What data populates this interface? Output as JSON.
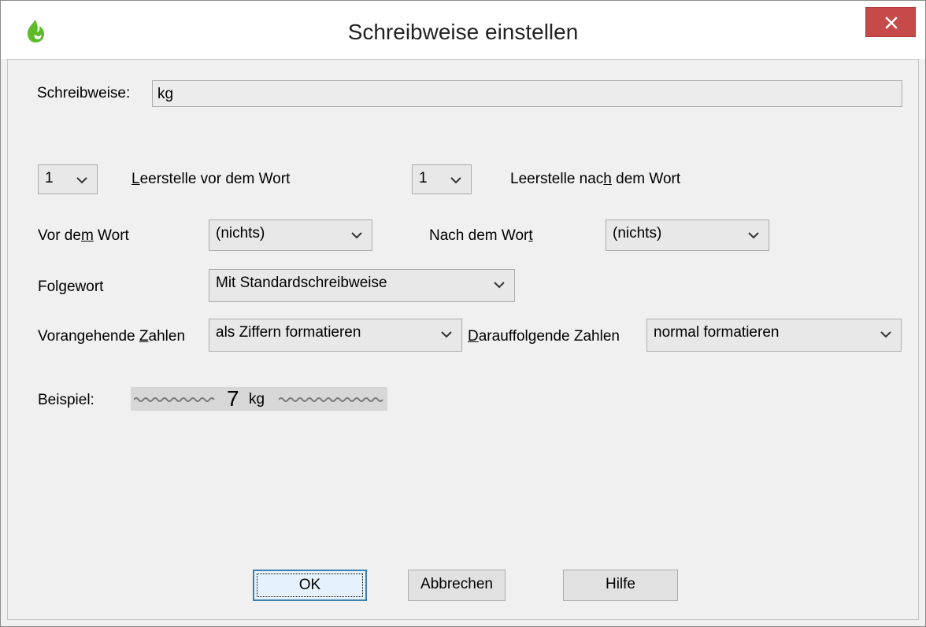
{
  "window": {
    "title": "Schreibweise einstellen",
    "close_label": "✕"
  },
  "form": {
    "schreibweise_label": "Schreibweise:",
    "schreibweise_value": "kg",
    "space_before_value": "1",
    "space_before_label": "Leerstelle vor dem Wort",
    "space_after_value": "1",
    "space_after_label": "Leerstelle nach dem Wort",
    "before_word_label": "Vor dem Wort",
    "before_word_value": "(nichts)",
    "after_word_label": "Nach dem Wort",
    "after_word_value": "(nichts)",
    "next_word_label": "Folgewort",
    "next_word_value": "Mit Standardschreibweise",
    "preceding_numbers_label": "Vorangehende Zahlen",
    "preceding_numbers_value": "als Ziffern formatieren",
    "following_numbers_label": "Darauffolgende Zahlen",
    "following_numbers_value": "normal formatieren",
    "example_label": "Beispiel:",
    "example_number": "7",
    "example_unit": "kg"
  },
  "buttons": {
    "ok": "OK",
    "cancel": "Abbrechen",
    "help": "Hilfe"
  },
  "colors": {
    "close_button": "#c74a4a",
    "dialog_background": "#f0f0f0",
    "icon_green": "#4caf1e"
  }
}
